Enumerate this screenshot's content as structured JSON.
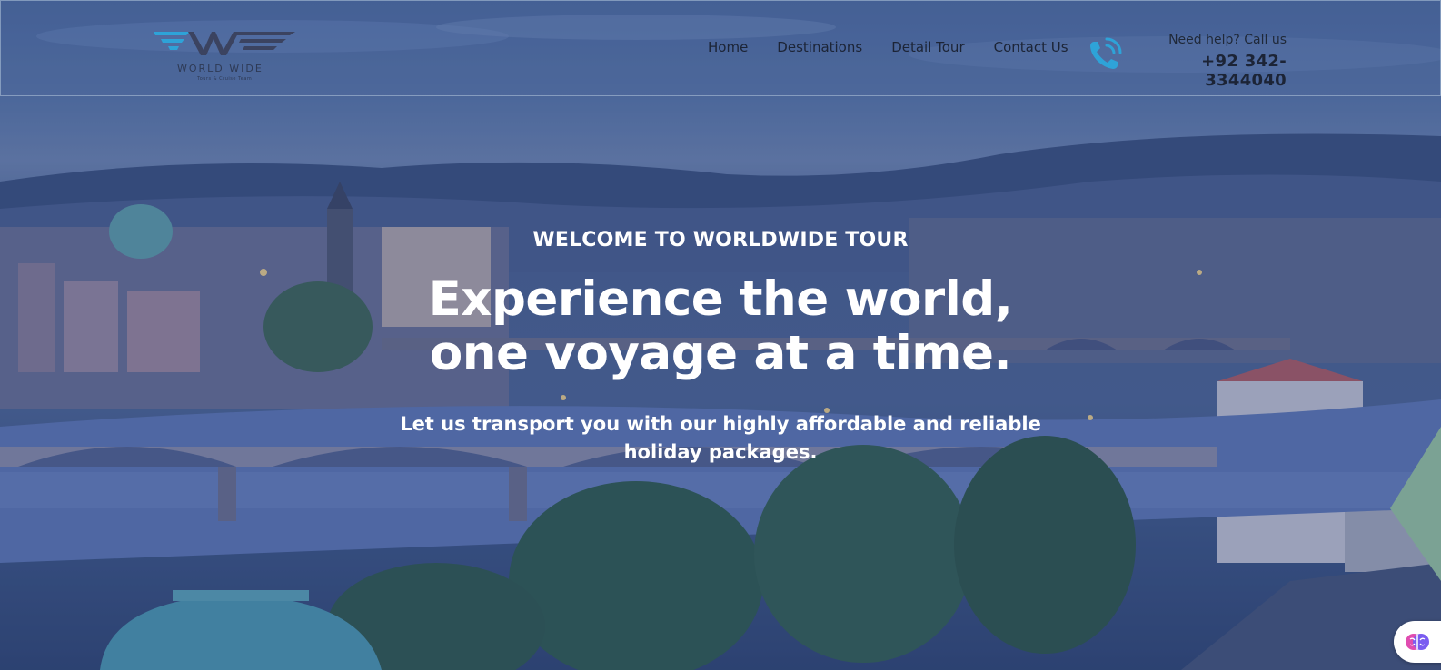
{
  "brand": {
    "name": "WORLD WIDE",
    "tagline": "Tours & Cruise Team",
    "color": "#2ea3d8"
  },
  "nav": {
    "items": [
      {
        "label": "Home"
      },
      {
        "label": "Destinations"
      },
      {
        "label": "Detail Tour"
      },
      {
        "label": "Contact Us"
      }
    ]
  },
  "contact": {
    "icon": "phone-call-icon",
    "label": "Need help? Call us",
    "number": "+92 342-3344040"
  },
  "hero": {
    "eyebrow": "WELCOME TO WORLDWIDE TOUR",
    "headline_line1": "Experience the world,",
    "headline_line2": "one voyage at a time.",
    "subtitle_line1": "Let us transport you with our highly affordable and reliable",
    "subtitle_line2": "holiday packages."
  },
  "chat": {
    "icon": "brain-icon"
  },
  "colors": {
    "accent": "#2ea3d8",
    "hero_text": "#ffffff",
    "nav_text": "#1c2436"
  }
}
